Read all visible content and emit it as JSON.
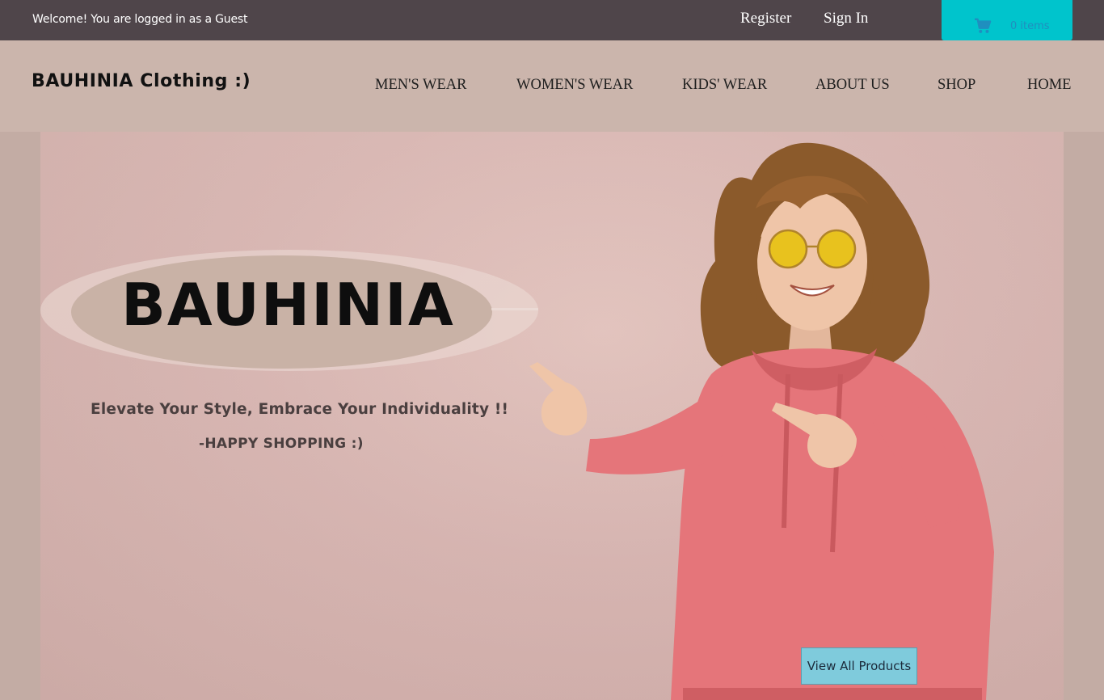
{
  "topbar": {
    "welcome": "Welcome! You are logged in as a Guest",
    "register_label": "Register",
    "signin_label": "Sign In",
    "cart": {
      "icon": "cart-icon",
      "count_label": "0 items",
      "color": "#00c4cc"
    }
  },
  "header": {
    "logo": "BAUHINIA  Clothing :)",
    "nav": [
      "MEN'S WEAR",
      "WOMEN'S WEAR",
      "KIDS' WEAR",
      "ABOUT US",
      "SHOP",
      "HOME"
    ]
  },
  "hero": {
    "brand": "BAUHINIA",
    "tagline": "Elevate Your Style, Embrace Your Individuality !!",
    "signoff": "-HAPPY SHOPPING :)",
    "cta_label": "View All Products"
  },
  "colors": {
    "topbar": "#4f454a",
    "header": "#cbb5ac",
    "hero_bg": "#d9b8b4",
    "cta": "#7fcbdc"
  }
}
